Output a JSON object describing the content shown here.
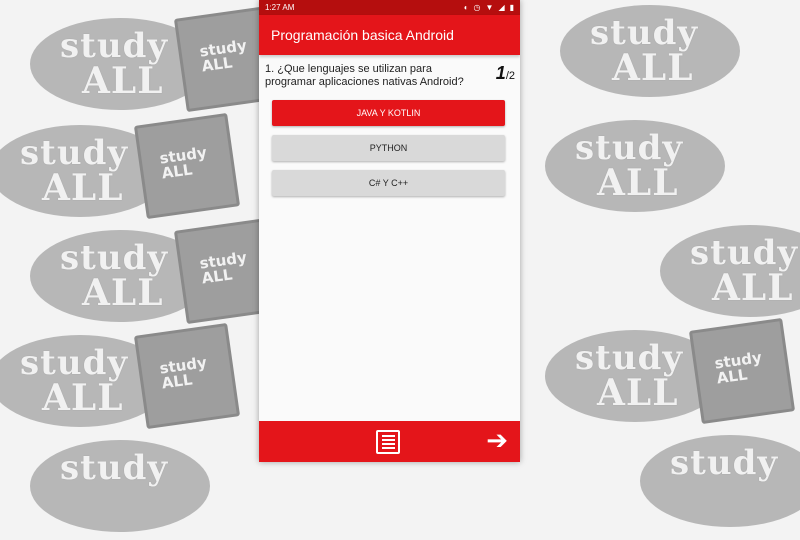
{
  "status": {
    "time": "1:27 AM"
  },
  "appbar": {
    "title": "Programación basica Android"
  },
  "question": {
    "text": "1. ¿Que lenguajes se utilizan para programar aplicaciones nativas Android?",
    "current": "1",
    "total": "/2"
  },
  "answers": [
    {
      "label": "JAVA Y KOTLIN",
      "selected": true
    },
    {
      "label": "PYTHON",
      "selected": false
    },
    {
      "label": "C# Y C++",
      "selected": false
    }
  ],
  "background": {
    "logo_word1": "study",
    "logo_word2": "ALL",
    "book_text": "study ALL"
  },
  "icons": {
    "list": "list-icon",
    "next": "arrow-right-icon"
  },
  "colors": {
    "primary": "#e4151a",
    "status_bar": "#b50e0e",
    "button": "#d9d9d9"
  }
}
